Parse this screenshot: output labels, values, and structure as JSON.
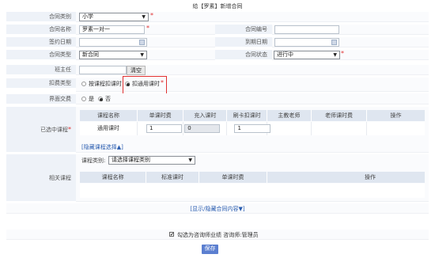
{
  "page": {
    "title": "给【罗素】新增合同"
  },
  "form": {
    "contract_category": {
      "label": "合同类别",
      "value": "小学"
    },
    "contract_name": {
      "label": "合同名称",
      "value": "罗素一对一"
    },
    "contract_no": {
      "label": "合同编号",
      "value": ""
    },
    "sign_date": {
      "label": "签约日期",
      "value": ""
    },
    "expire_date": {
      "label": "到期日期",
      "value": ""
    },
    "contract_type": {
      "label": "合同类型",
      "value": "新合同"
    },
    "contract_status": {
      "label": "合同状态",
      "value": "进行中"
    },
    "head_teacher": {
      "label": "班主任",
      "value": "",
      "clear_label": "清空"
    },
    "deduct_type": {
      "label": "扣费类型",
      "option_course": "按课程扣课时",
      "option_general": "扣通用课时",
      "selected": "扣通用课时"
    },
    "ui_fee": {
      "label": "界面交费",
      "option_yes": "是",
      "option_no": "否",
      "selected": "否"
    },
    "selected_courses": {
      "label": "已选中课程",
      "headers": [
        "课程名称",
        "单课时费",
        "充入课时",
        "刷卡扣课时",
        "主教老师",
        "老师课时费",
        "操作"
      ],
      "row": {
        "name": "通用课时",
        "unit_fee": "1",
        "charged_hours": "0",
        "card_deduct": "1"
      },
      "hide_link": "[隐藏课程选择▲]"
    },
    "related_courses": {
      "label": "相关课程",
      "category_label": "课程类别:",
      "category_value": "请选择课程类别",
      "headers": [
        "课程名称",
        "标准课时",
        "单课时费",
        "操作"
      ]
    },
    "toggle_link": "[显示/隐藏合同内容▼]",
    "consultant_check": {
      "label": "勾选为咨询师业绩 咨询师:管理员",
      "checked": true
    },
    "save_label": "保存"
  },
  "colors": {
    "label_bg": "#eef2f8",
    "header_bg": "#dfe6f0",
    "required": "#e03030",
    "link": "#2a5db0",
    "save": "#5b7fd0"
  }
}
